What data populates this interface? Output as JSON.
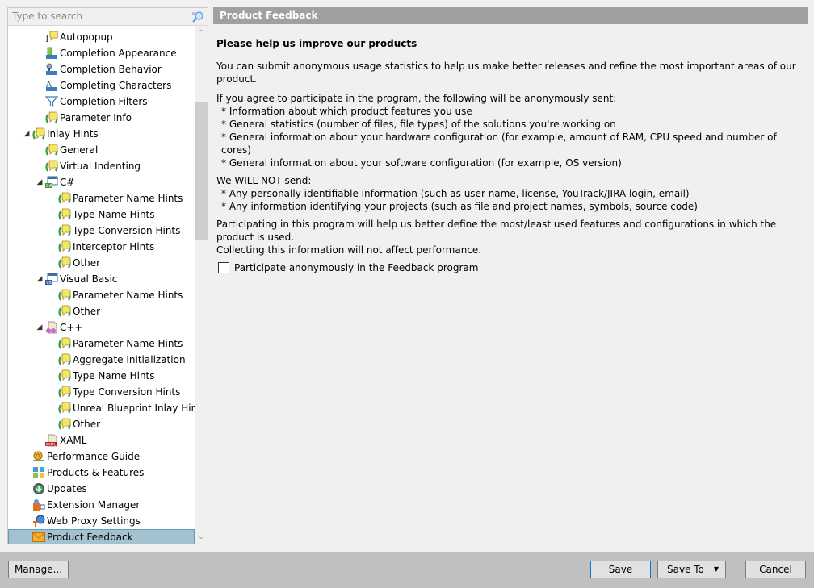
{
  "search": {
    "placeholder": "Type to search",
    "value": ""
  },
  "tree": [
    {
      "label": "Autopopup",
      "icon": "autopopup-icon",
      "level": 2,
      "expanded": null,
      "selected": false
    },
    {
      "label": "Completion Appearance",
      "icon": "completion-appearance-icon",
      "level": 2,
      "expanded": null,
      "selected": false
    },
    {
      "label": "Completion Behavior",
      "icon": "completion-behavior-icon",
      "level": 2,
      "expanded": null,
      "selected": false
    },
    {
      "label": "Completing Characters",
      "icon": "completing-characters-icon",
      "level": 2,
      "expanded": null,
      "selected": false
    },
    {
      "label": "Completion Filters",
      "icon": "filter-icon",
      "level": 2,
      "expanded": null,
      "selected": false
    },
    {
      "label": "Parameter Info",
      "icon": "inlay-hint-icon",
      "level": 2,
      "expanded": null,
      "selected": false
    },
    {
      "label": "Inlay Hints",
      "icon": "inlay-hint-icon",
      "level": 1,
      "expanded": true,
      "selected": false
    },
    {
      "label": "General",
      "icon": "inlay-hint-icon",
      "level": 2,
      "expanded": null,
      "selected": false
    },
    {
      "label": "Virtual Indenting",
      "icon": "inlay-hint-icon",
      "level": 2,
      "expanded": null,
      "selected": false
    },
    {
      "label": "C#",
      "icon": "csharp-icon",
      "level": 2,
      "expanded": true,
      "selected": false
    },
    {
      "label": "Parameter Name Hints",
      "icon": "inlay-hint-icon",
      "level": 3,
      "expanded": null,
      "selected": false
    },
    {
      "label": "Type Name Hints",
      "icon": "inlay-hint-icon",
      "level": 3,
      "expanded": null,
      "selected": false
    },
    {
      "label": "Type Conversion Hints",
      "icon": "inlay-hint-icon",
      "level": 3,
      "expanded": null,
      "selected": false
    },
    {
      "label": "Interceptor Hints",
      "icon": "inlay-hint-icon",
      "level": 3,
      "expanded": null,
      "selected": false
    },
    {
      "label": "Other",
      "icon": "inlay-hint-icon",
      "level": 3,
      "expanded": null,
      "selected": false
    },
    {
      "label": "Visual Basic",
      "icon": "vb-icon",
      "level": 2,
      "expanded": true,
      "selected": false
    },
    {
      "label": "Parameter Name Hints",
      "icon": "inlay-hint-icon",
      "level": 3,
      "expanded": null,
      "selected": false
    },
    {
      "label": "Other",
      "icon": "inlay-hint-icon",
      "level": 3,
      "expanded": null,
      "selected": false
    },
    {
      "label": "C++",
      "icon": "cpp-icon",
      "level": 2,
      "expanded": true,
      "selected": false
    },
    {
      "label": "Parameter Name Hints",
      "icon": "inlay-hint-icon",
      "level": 3,
      "expanded": null,
      "selected": false
    },
    {
      "label": "Aggregate Initialization",
      "icon": "inlay-hint-icon",
      "level": 3,
      "expanded": null,
      "selected": false
    },
    {
      "label": "Type Name Hints",
      "icon": "inlay-hint-icon",
      "level": 3,
      "expanded": null,
      "selected": false
    },
    {
      "label": "Type Conversion Hints",
      "icon": "inlay-hint-icon",
      "level": 3,
      "expanded": null,
      "selected": false
    },
    {
      "label": "Unreal Blueprint Inlay Hints",
      "icon": "inlay-hint-icon",
      "level": 3,
      "expanded": null,
      "selected": false
    },
    {
      "label": "Other",
      "icon": "inlay-hint-icon",
      "level": 3,
      "expanded": null,
      "selected": false
    },
    {
      "label": "XAML",
      "icon": "xaml-icon",
      "level": 2,
      "expanded": null,
      "selected": false
    },
    {
      "label": "Performance Guide",
      "icon": "snail-icon",
      "level": 1,
      "expanded": null,
      "selected": false
    },
    {
      "label": "Products & Features",
      "icon": "products-icon",
      "level": 1,
      "expanded": null,
      "selected": false
    },
    {
      "label": "Updates",
      "icon": "updates-icon",
      "level": 1,
      "expanded": null,
      "selected": false
    },
    {
      "label": "Extension Manager",
      "icon": "extension-manager-icon",
      "level": 1,
      "expanded": null,
      "selected": false
    },
    {
      "label": "Web Proxy Settings",
      "icon": "web-proxy-icon",
      "level": 1,
      "expanded": null,
      "selected": false
    },
    {
      "label": "Product Feedback",
      "icon": "envelope-icon",
      "level": 1,
      "expanded": null,
      "selected": true
    }
  ],
  "panel": {
    "header": "Product Feedback",
    "title": "Please help us improve our products",
    "intro": "You can submit anonymous usage statistics to help us make better releases and refine the most important areas of our product.",
    "send_heading": "If you agree to participate in the program, the following will be anonymously sent:",
    "send_items": [
      "* Information about which product features you use",
      "* General statistics (number of files, file types) of the solutions you're working on",
      "* General information about your hardware configuration (for example, amount of RAM, CPU speed and number of cores)",
      "* General information about your software configuration (for example, OS version)"
    ],
    "not_send_heading": "We WILL NOT send:",
    "not_send_items": [
      "* Any personally identifiable information (such as user name, license, YouTrack/JIRA login, email)",
      "* Any information identifying your projects (such as file and project names, symbols, source code)"
    ],
    "closing_1": "Participating in this program will help us better define the most/least used features and configurations in which the product is used.",
    "closing_2": "Collecting this information will not affect performance.",
    "checkbox_label": "Participate anonymously in the Feedback program",
    "checkbox_checked": false
  },
  "footer": {
    "manage": "Manage...",
    "save": "Save",
    "save_to": "Save To",
    "cancel": "Cancel"
  }
}
